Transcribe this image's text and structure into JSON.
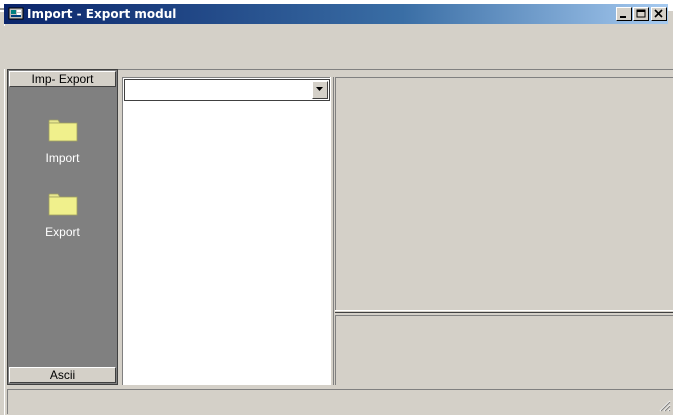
{
  "window": {
    "title": "Import - Export modul",
    "controls": [
      "minimize",
      "maximize",
      "close"
    ]
  },
  "outlook_bar": {
    "header": "Imp- Export",
    "items": [
      {
        "label": "Import",
        "icon": "folder-icon"
      },
      {
        "label": "Export",
        "icon": "folder-icon"
      }
    ],
    "footer": "Ascii"
  },
  "file_panel": {
    "combo_value": ""
  },
  "colors": {
    "title_gradient_start": "#0a246a",
    "title_gradient_end": "#a6caf0",
    "face": "#d4d0c8",
    "outlook_bg": "#808080",
    "folder": "#f0f08c"
  }
}
